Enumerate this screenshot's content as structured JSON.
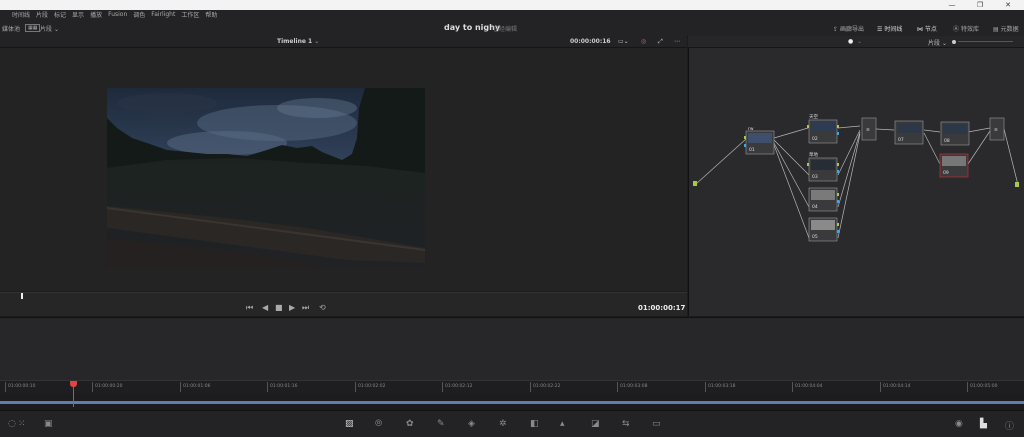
{
  "menu": {
    "items": [
      "",
      "时间线",
      "片段",
      "标记",
      "显示",
      "播放",
      "Fusion",
      "调色",
      "Fairlight",
      "工作区",
      "帮助"
    ]
  },
  "topbar": {
    "left_label": "媒体池",
    "clip_view_label": "片段",
    "project_title": "day to nighy",
    "project_status": "已经编辑",
    "right_items": [
      "画廊导出",
      "时间线",
      "节点",
      "特效库",
      "元数据"
    ]
  },
  "viewer": {
    "timeline_name": "Timeline 1",
    "source_timecode": "00:00:00:16",
    "record_timecode": "01:00:00:17"
  },
  "nodes": {
    "mode_label": "片段",
    "items": [
      {
        "num": "01",
        "label": "rw"
      },
      {
        "num": "02",
        "label": "天空"
      },
      {
        "num": "03",
        "label": "草地"
      },
      {
        "num": "04",
        "label": ""
      },
      {
        "num": "05",
        "label": ""
      },
      {
        "num": "07",
        "label": ""
      },
      {
        "num": "08",
        "label": ""
      },
      {
        "num": "09",
        "label": ""
      }
    ]
  },
  "timeline_ruler": {
    "ticks": [
      "01:00:00:10",
      "01:00:00:20",
      "01:00:01:06",
      "01:00:01:16",
      "01:00:02:02",
      "01:00:02:12",
      "01:00:02:22",
      "01:00:03:08",
      "01:00:03:18",
      "01:00:04:04",
      "01:00:04:14",
      "01:00:05:00"
    ]
  },
  "colors": {
    "accent_blue": "#5f7fb0",
    "playhead_red": "#e04545",
    "node_link_green": "#a8c94a",
    "node_link_blue": "#3ea6e0",
    "selected_node_red": "#b03030"
  }
}
